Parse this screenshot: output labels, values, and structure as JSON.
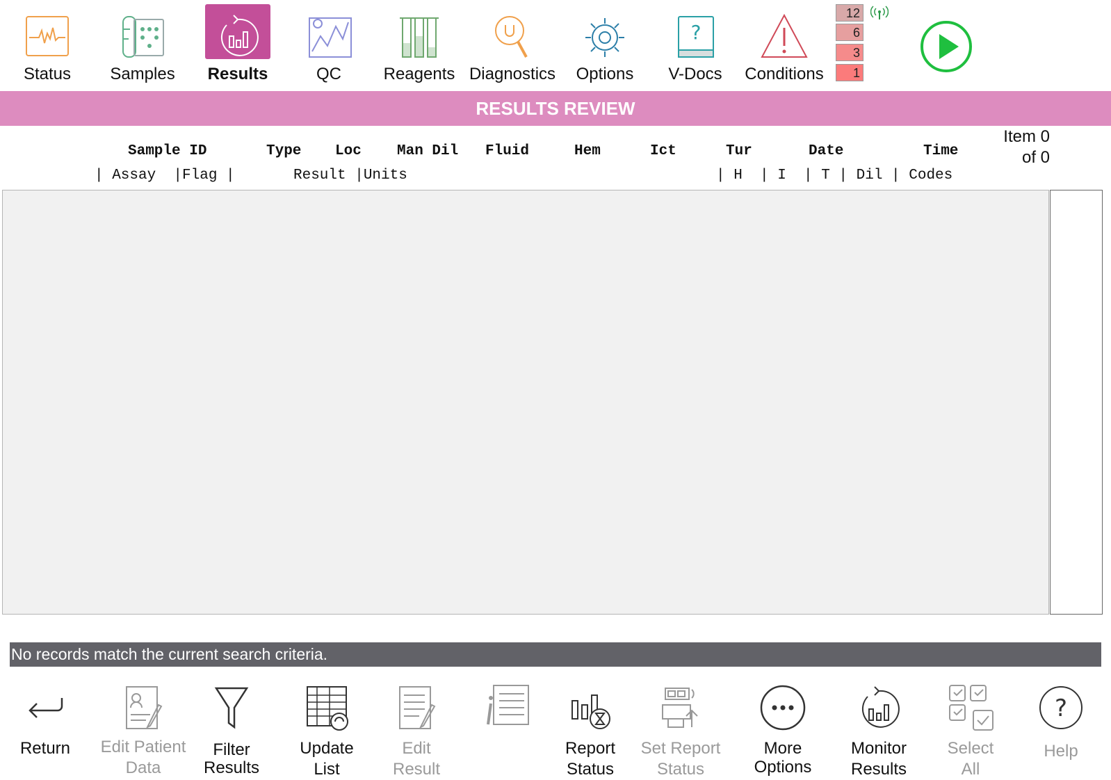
{
  "nav": {
    "items": [
      {
        "label": "Status",
        "icon": "status-monitor-icon"
      },
      {
        "label": "Samples",
        "icon": "samples-rack-icon"
      },
      {
        "label": "Results",
        "icon": "results-chart-icon",
        "active": true
      },
      {
        "label": "QC",
        "icon": "qc-chart-icon"
      },
      {
        "label": "Reagents",
        "icon": "reagents-icon"
      },
      {
        "label": "Diagnostics",
        "icon": "diagnostics-wrench-icon"
      },
      {
        "label": "Options",
        "icon": "options-gear-icon"
      },
      {
        "label": "V-Docs",
        "icon": "vdocs-book-icon"
      },
      {
        "label": "Conditions",
        "icon": "warning-triangle-icon"
      }
    ],
    "counters": [
      "12",
      "6",
      "3",
      "1"
    ],
    "counter_colors": [
      "#d8a9a9",
      "#e69f9f",
      "#f58b8b",
      "#fb7b7b"
    ],
    "signal_icon": "antenna-signal-icon",
    "run_icon": "run-play-icon",
    "active_color": "#c34f99"
  },
  "title_bar": {
    "text": "RESULTS REVIEW",
    "color": "#dd8cbf"
  },
  "columns": {
    "row1": [
      "Sample ID",
      "Type",
      "Loc",
      "Man Dil",
      "Fluid",
      "Hem",
      "Ict",
      "Tur",
      "Date",
      "Time"
    ],
    "row2a": "| Assay  |Flag |",
    "row2b": "Result |Units",
    "row2c": "| H  | I  | T | Dil | Codes"
  },
  "item_count": {
    "line1": "Item 0",
    "line2": "of 0"
  },
  "status_message": "No records match the current search criteria.",
  "toolbar": [
    {
      "line1": "Return",
      "line2": "",
      "icon": "return-arrow-icon",
      "enabled": true
    },
    {
      "line1": "Edit Patient",
      "line2": "Data",
      "icon": "edit-patient-icon",
      "enabled": false
    },
    {
      "line1": "Filter",
      "line2": "Results",
      "icon": "filter-funnel-icon",
      "enabled": true
    },
    {
      "line1": "Update",
      "line2": "List",
      "icon": "update-list-icon",
      "enabled": true
    },
    {
      "line1": "Edit",
      "line2": "Result",
      "icon": "edit-result-icon",
      "enabled": false
    },
    {
      "line1": "",
      "line2": "",
      "icon": "info-list-icon",
      "enabled": false
    },
    {
      "line1": "Report",
      "line2": "Status",
      "icon": "report-status-icon",
      "enabled": true
    },
    {
      "line1": "Set Report",
      "line2": "Status",
      "icon": "set-report-status-icon",
      "enabled": false
    },
    {
      "line1": "More",
      "line2": "Options",
      "icon": "more-options-icon",
      "enabled": true
    },
    {
      "line1": "Monitor",
      "line2": "Results",
      "icon": "monitor-results-icon",
      "enabled": true
    },
    {
      "line1": "Select",
      "line2": "All",
      "icon": "select-all-icon",
      "enabled": false
    },
    {
      "line1": "Help",
      "line2": "",
      "icon": "help-question-icon",
      "enabled": false
    }
  ]
}
